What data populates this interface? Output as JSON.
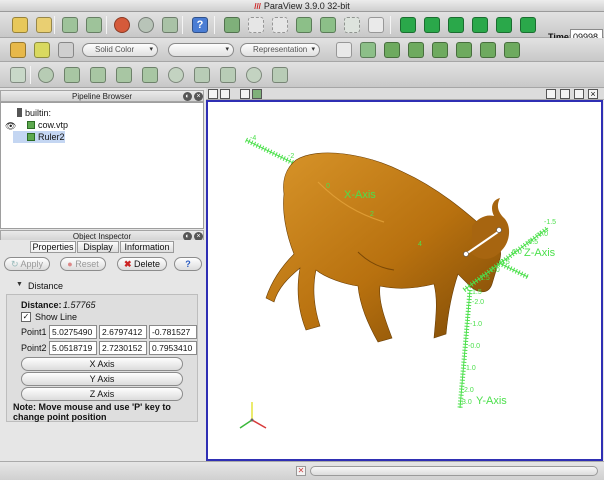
{
  "window": {
    "title": "ParaView 3.9.0 32-bit"
  },
  "toolbar": {
    "time_label": "Time:",
    "time_value": "09998",
    "color_by": "Solid Color",
    "representation": "Representation"
  },
  "pipeline_browser": {
    "title": "Pipeline Browser",
    "items": [
      {
        "label": "builtin:"
      },
      {
        "label": "cow.vtp"
      },
      {
        "label": "Ruler2"
      }
    ]
  },
  "object_inspector": {
    "title": "Object Inspector",
    "tabs": [
      "Properties",
      "Display",
      "Information"
    ],
    "apply_label": "Apply",
    "reset_label": "Reset",
    "delete_label": "Delete",
    "help_label": "?"
  },
  "distance": {
    "section_label": "Distance",
    "distance_label": "Distance:",
    "distance_value": "1.57765",
    "show_line_label": "Show Line",
    "show_line": true,
    "point1_label": "Point1",
    "point1": [
      "5.0275490",
      "2.6797412",
      "-0.781527"
    ],
    "point2_label": "Point2",
    "point2": [
      "5.0518719",
      "2.7230152",
      "0.7953410"
    ],
    "x_axis_button": "X Axis",
    "y_axis_button": "Y Axis",
    "z_axis_button": "Z Axis",
    "note": "Note: Move mouse and use 'P' key to change point position"
  },
  "view": {
    "x_axis_label": "X-Axis",
    "y_axis_label": "Y-Axis",
    "z_axis_label": "Z-Axis",
    "x_ticks": [
      "-4",
      "-2",
      "0",
      "2",
      "4"
    ],
    "y_ticks": [
      "1.5",
      "-2.0",
      "-1.0",
      "-0.0",
      "1.0",
      "2.0",
      "3.0"
    ],
    "z_ticks": [
      "-1.5",
      "-1.0",
      "-0.5",
      "0.0",
      "0.5",
      "1.0",
      "1.5"
    ],
    "colors": {
      "cow": "#b8710f",
      "axes": "#4ce04c",
      "border": "#2f2fb4"
    }
  }
}
